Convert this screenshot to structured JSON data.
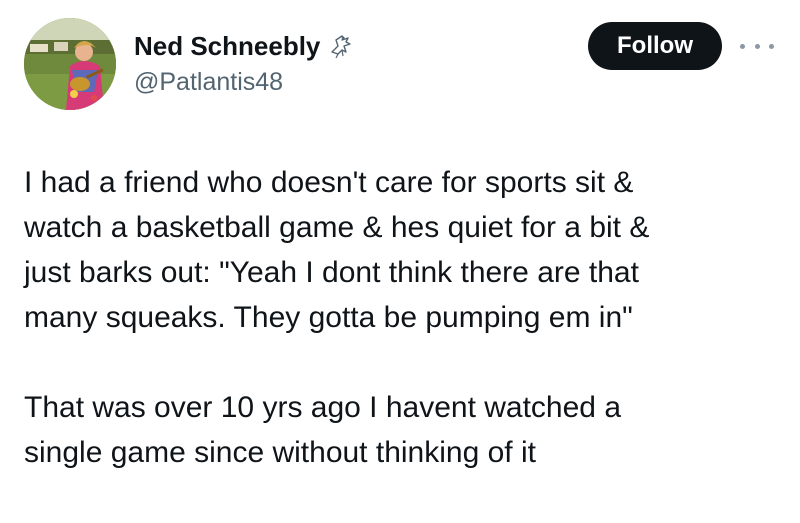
{
  "user": {
    "display_name": "Ned Schneebly",
    "handle": "@Patlantis48",
    "badge_icon": "bird-icon",
    "avatar": "avatar-photo"
  },
  "actions": {
    "follow_label": "Follow",
    "more_icon": "more-options-icon"
  },
  "tweet": {
    "paragraphs": [
      "I had a friend who doesn't care for sports sit &\nwatch a basketball game & hes quiet for a bit &\njust barks out: \"Yeah I dont think there are that\nmany squeaks. They gotta be pumping em in\"",
      "That was over 10 yrs ago I havent watched a\nsingle game since without thinking of it"
    ]
  },
  "colors": {
    "text": "#0f1419",
    "secondary_text": "#536471",
    "follow_bg": "#0f1419",
    "follow_text": "#ffffff"
  }
}
